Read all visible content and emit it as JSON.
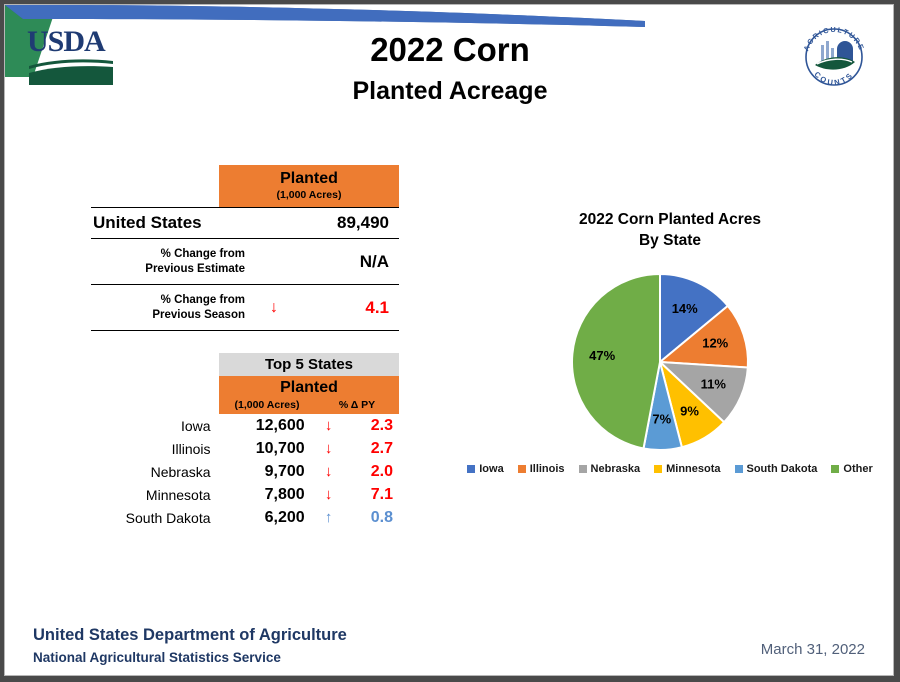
{
  "header": {
    "title": "2022 Corn",
    "subtitle": "Planted Acreage",
    "usda_logo_text": "USDA",
    "seal_top_text": "AGRICULTURE",
    "seal_bottom_text": "COUNTS"
  },
  "national_table": {
    "column_header": "Planted",
    "column_units": "(1,000 Acres)",
    "rows": [
      {
        "label": "United States",
        "value": "89,490",
        "arrow": "",
        "arrow_dir": "none"
      },
      {
        "label_line1": "% Change from",
        "label_line2": "Previous Estimate",
        "value": "N/A",
        "arrow": "",
        "arrow_dir": "none"
      },
      {
        "label_line1": "% Change from",
        "label_line2": "Previous Season",
        "value": "4.1",
        "arrow": "↓",
        "arrow_dir": "down"
      }
    ]
  },
  "top5_table": {
    "title": "Top 5 States",
    "column_header": "Planted",
    "col_acres": "(1,000 Acres)",
    "col_pct": "% Δ PY",
    "rows": [
      {
        "state": "Iowa",
        "value": "12,600",
        "arrow": "↓",
        "arrow_dir": "down",
        "pct": "2.3"
      },
      {
        "state": "Illinois",
        "value": "10,700",
        "arrow": "↓",
        "arrow_dir": "down",
        "pct": "2.7"
      },
      {
        "state": "Nebraska",
        "value": "9,700",
        "arrow": "↓",
        "arrow_dir": "down",
        "pct": "2.0"
      },
      {
        "state": "Minnesota",
        "value": "7,800",
        "arrow": "↓",
        "arrow_dir": "down",
        "pct": "7.1"
      },
      {
        "state": "South Dakota",
        "value": "6,200",
        "arrow": "↑",
        "arrow_dir": "up",
        "pct": "0.8"
      }
    ]
  },
  "chart_data": {
    "type": "pie",
    "title": "2022 Corn Planted Acres",
    "title_line2": "By State",
    "categories": [
      "Iowa",
      "Illinois",
      "Nebraska",
      "Minnesota",
      "South Dakota",
      "Other"
    ],
    "values": [
      14,
      12,
      11,
      9,
      7,
      47
    ],
    "labels": [
      "14%",
      "12%",
      "11%",
      "9%",
      "7%",
      "47%"
    ],
    "colors": [
      "#4472C4",
      "#ED7D31",
      "#A5A5A5",
      "#FFC000",
      "#5B9BD5",
      "#70AD47"
    ],
    "legend_position": "bottom",
    "start_angle": 0,
    "units": "percent of total planted acres"
  },
  "footer": {
    "organization": "United States Department of Agriculture",
    "service": "National Agricultural Statistics Service",
    "date": "March 31, 2022"
  },
  "colors": {
    "orange": "#ED7D31",
    "gray_header": "#D9D9D9",
    "navy": "#1F3864",
    "decrease_red": "#FF0000",
    "increase_blue": "#5B8FD0"
  }
}
